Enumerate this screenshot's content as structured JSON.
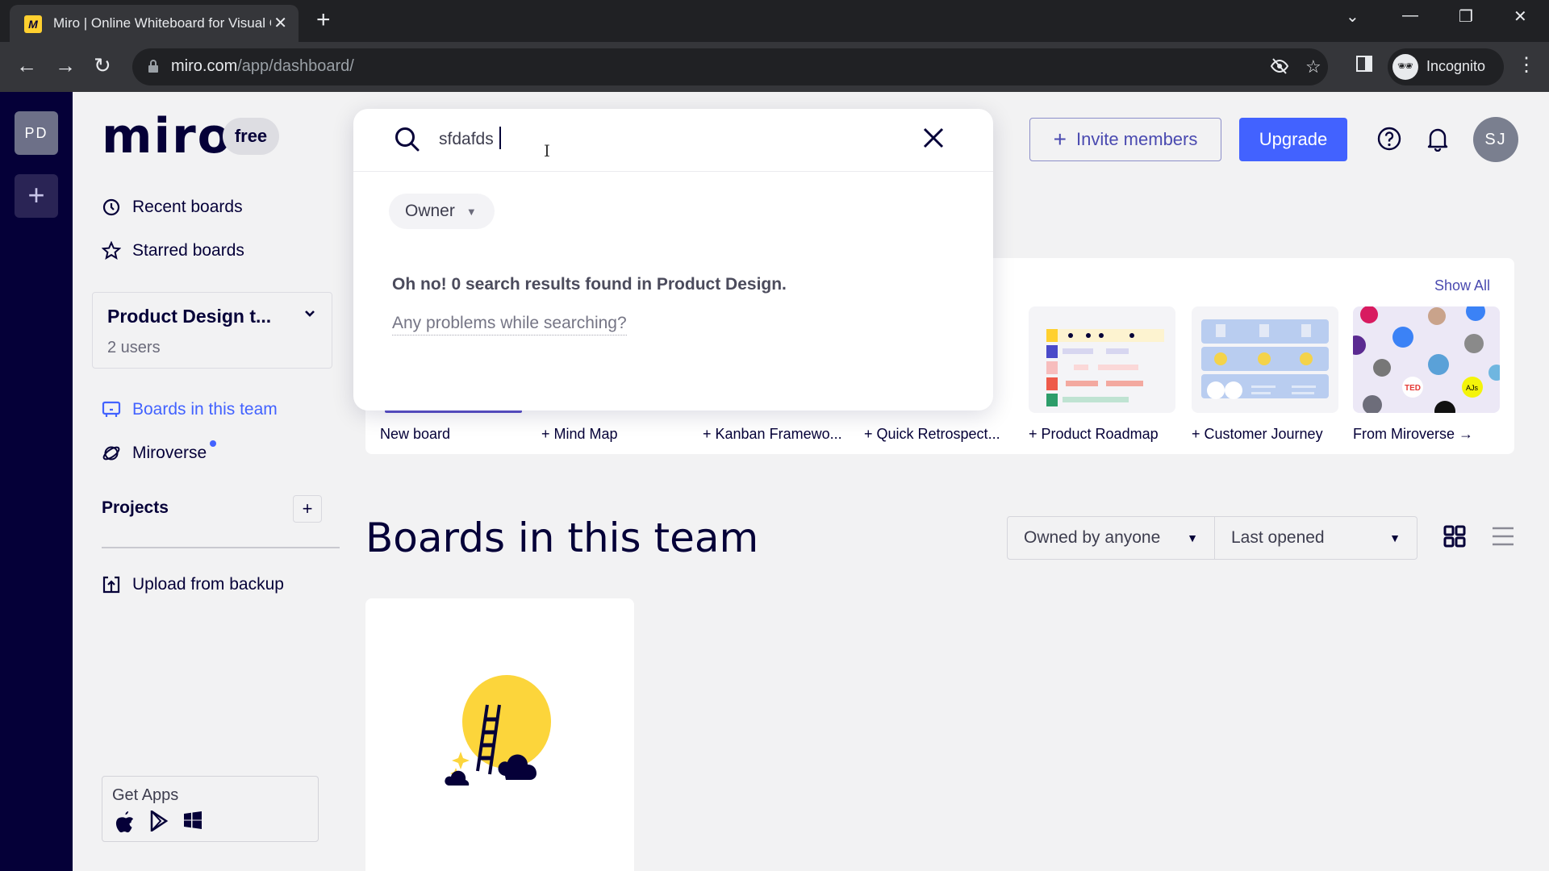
{
  "browser": {
    "tab_title": "Miro | Online Whiteboard for Visual Collaboration",
    "tab_favicon": "miro-favicon",
    "url_host": "miro.com",
    "url_path": "/app/dashboard/",
    "profile_label": "Incognito"
  },
  "rail": {
    "team_initials": "PD",
    "add_label": "+"
  },
  "sidebar": {
    "logo": "miro",
    "plan": "free",
    "nav": [
      {
        "label": "Recent boards",
        "icon": "clock-icon"
      },
      {
        "label": "Starred boards",
        "icon": "star-icon"
      }
    ],
    "team": {
      "name": "Product Design t...",
      "users": "2 users"
    },
    "team_nav": [
      {
        "label": "Boards in this team",
        "icon": "board-icon",
        "active": true
      },
      {
        "label": "Miroverse",
        "icon": "planet-icon",
        "badge": "new-dot"
      }
    ],
    "projects_label": "Projects",
    "upload_label": "Upload from backup",
    "get_apps_label": "Get Apps"
  },
  "header": {
    "invite_label": "Invite members",
    "upgrade_label": "Upgrade",
    "avatar_initials": "SJ"
  },
  "search": {
    "query": "sfdafds",
    "filter_label": "Owner",
    "no_results": "Oh no! 0 search results found in Product Design.",
    "problems_link": "Any problems while searching?"
  },
  "templates": {
    "show_all": "Show All",
    "items": [
      {
        "label": "New board"
      },
      {
        "label": "+ Mind Map"
      },
      {
        "label": "+ Kanban Framewo..."
      },
      {
        "label": "+ Quick Retrospect..."
      },
      {
        "label": "+ Product Roadmap"
      },
      {
        "label": "+ Customer Journey"
      },
      {
        "label": "From Miroverse →"
      }
    ]
  },
  "boards": {
    "title": "Boards in this team",
    "owner_filter": "Owned by anyone",
    "sort": "Last opened"
  },
  "colors": {
    "accent": "#4262ff",
    "rail": "#050038",
    "text": "#050038",
    "link": "#4a4ab0"
  }
}
